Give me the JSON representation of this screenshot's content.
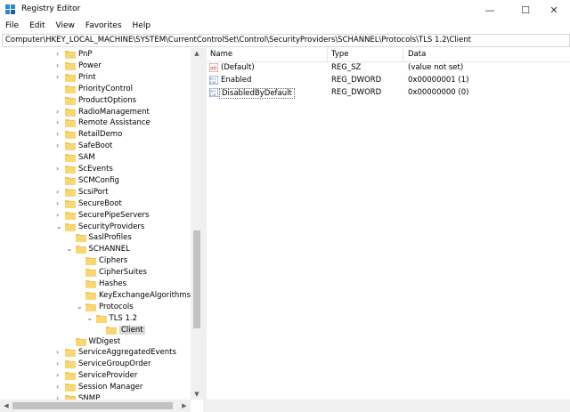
{
  "window": {
    "title": "Registry Editor",
    "minimize": "—",
    "maximize": "☐",
    "close": "✕"
  },
  "menu": [
    "File",
    "Edit",
    "View",
    "Favorites",
    "Help"
  ],
  "address": "Computer\\HKEY_LOCAL_MACHINE\\SYSTEM\\CurrentControlSet\\Control\\SecurityProviders\\SCHANNEL\\Protocols\\TLS 1.2\\Client",
  "tree": [
    {
      "label": "PnP",
      "chevron": ">"
    },
    {
      "label": "Power",
      "chevron": ">"
    },
    {
      "label": "Print",
      "chevron": ">"
    },
    {
      "label": "PriorityControl",
      "chevron": ""
    },
    {
      "label": "ProductOptions",
      "chevron": ""
    },
    {
      "label": "RadioManagement",
      "chevron": ">"
    },
    {
      "label": "Remote Assistance",
      "chevron": ">"
    },
    {
      "label": "RetailDemo",
      "chevron": ">"
    },
    {
      "label": "SafeBoot",
      "chevron": ">"
    },
    {
      "label": "SAM",
      "chevron": ""
    },
    {
      "label": "ScEvents",
      "chevron": ">"
    },
    {
      "label": "SCMConfig",
      "chevron": ""
    },
    {
      "label": "ScsiPort",
      "chevron": ">"
    },
    {
      "label": "SecureBoot",
      "chevron": ">"
    },
    {
      "label": "SecurePipeServers",
      "chevron": ">"
    },
    {
      "label": "SecurityProviders",
      "chevron": "v"
    },
    {
      "label": "SaslProfiles",
      "chevron": ""
    },
    {
      "label": "SCHANNEL",
      "chevron": "v"
    },
    {
      "label": "Ciphers",
      "chevron": ""
    },
    {
      "label": "CipherSuites",
      "chevron": ""
    },
    {
      "label": "Hashes",
      "chevron": ""
    },
    {
      "label": "KeyExchangeAlgorithms",
      "chevron": ""
    },
    {
      "label": "Protocols",
      "chevron": "v"
    },
    {
      "label": "TLS 1.2",
      "chevron": "v"
    },
    {
      "label": "Client",
      "chevron": ""
    },
    {
      "label": "WDigest",
      "chevron": ""
    },
    {
      "label": "ServiceAggregatedEvents",
      "chevron": ">"
    },
    {
      "label": "ServiceGroupOrder",
      "chevron": ">"
    },
    {
      "label": "ServiceProvider",
      "chevron": ">"
    },
    {
      "label": "Session Manager",
      "chevron": ">"
    },
    {
      "label": "SNMP",
      "chevron": ">"
    }
  ],
  "columns": {
    "name": "Name",
    "type": "Type",
    "data": "Data"
  },
  "values": [
    {
      "name": "(Default)",
      "type": "REG_SZ",
      "data": "(value not set)",
      "icon": "string-value-icon"
    },
    {
      "name": "Enabled",
      "type": "REG_DWORD",
      "data": "0x00000001 (1)",
      "icon": "dword-value-icon"
    },
    {
      "name": "DisabledByDefault",
      "type": "REG_DWORD",
      "data": "0x00000000 (0)",
      "icon": "dword-value-icon"
    }
  ],
  "colors": {
    "folder": "#f3c852",
    "selection": "#d9d9d9",
    "accent": "#0078d7"
  }
}
